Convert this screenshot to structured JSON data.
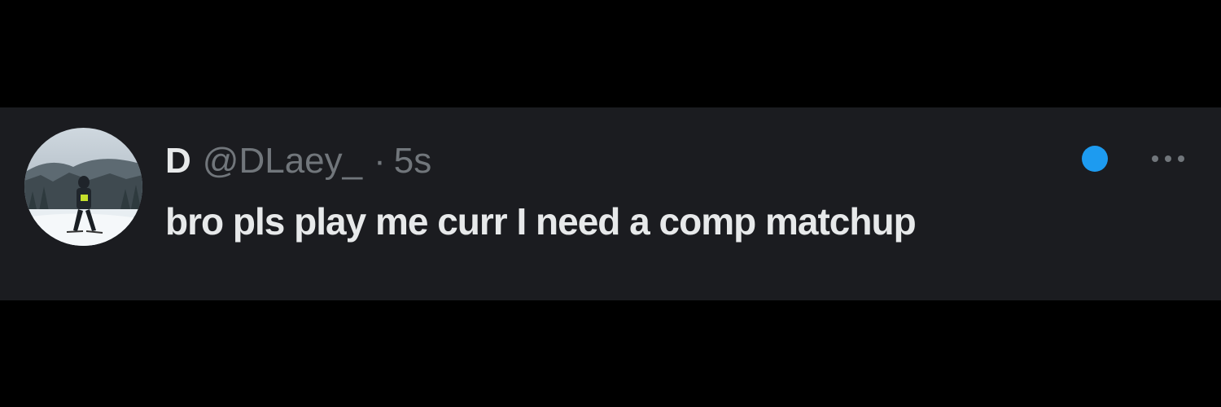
{
  "tweet": {
    "display_name": "D",
    "handle": "@DLaey_",
    "separator": "·",
    "timestamp": "5s",
    "text": "bro pls play me curr I need a comp matchup",
    "avatar_icon": "user-avatar-skier-photo",
    "unread_indicator_color": "#1d9bf0",
    "more_icon": "more-horizontal-icon"
  },
  "colors": {
    "background": "#000000",
    "card": "#1b1c20",
    "primary_text": "#e7e9ea",
    "secondary_text": "#71767b",
    "accent": "#1d9bf0"
  }
}
